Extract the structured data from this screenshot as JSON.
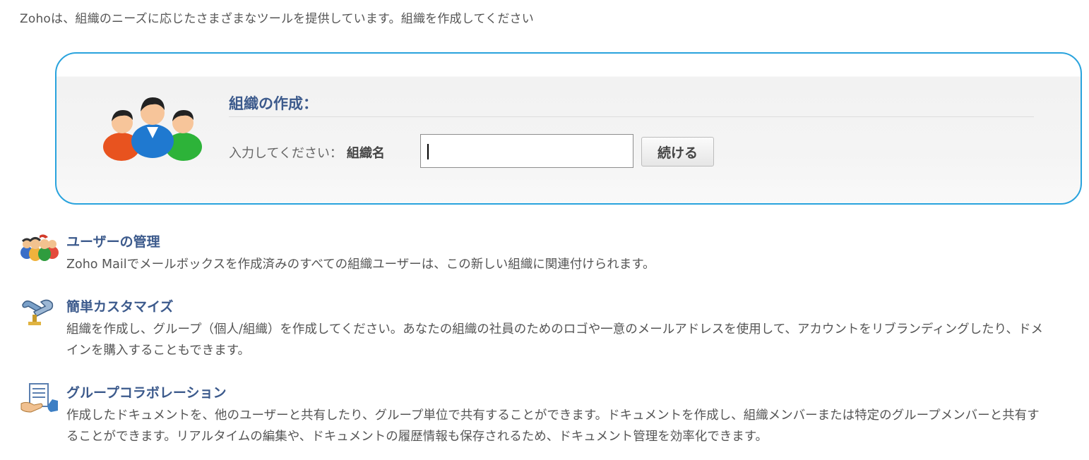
{
  "intro": "Zohoは、組織のニーズに応じたさまざまなツールを提供しています。組織を作成してください",
  "org_form": {
    "title": "組織の作成：",
    "prompt": "入力してください：",
    "field_label": "組織名",
    "input_value": "",
    "continue_label": "続ける"
  },
  "features": [
    {
      "icon": "users-group-icon",
      "title": "ユーザーの管理",
      "description": "Zoho Mailでメールボックスを作成済みのすべての組織ユーザーは、この新しい組織に関連付けられます。"
    },
    {
      "icon": "customize-tools-icon",
      "title": "簡単カスタマイズ",
      "description": "組織を作成し、グループ（個人/組織）を作成してください。あなたの組織の社員のためのロゴや一意のメールアドレスを使用して、アカウントをリブランディングしたり、ドメインを購入することもできます。"
    },
    {
      "icon": "collaboration-icon",
      "title": "グループコラボレーション",
      "description": "作成したドキュメントを、他のユーザーと共有したり、グループ単位で共有することができます。ドキュメントを作成し、組織メンバーまたは特定のグループメンバーと共有することができます。リアルタイムの編集や、ドキュメントの履歴情報も保存されるため、ドキュメント管理を効率化できます。"
    }
  ],
  "colors": {
    "accent_border": "#29a3dd",
    "title_blue": "#3c5a8c"
  }
}
